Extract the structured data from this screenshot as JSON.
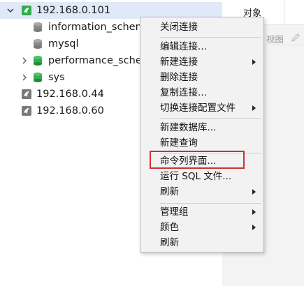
{
  "tree": {
    "connections": [
      {
        "label": "192.168.0.101",
        "expanded": true,
        "selected": true,
        "status": "connected"
      },
      {
        "label": "192.168.0.44",
        "status": "disconnected"
      },
      {
        "label": "192.168.0.60",
        "status": "disconnected"
      }
    ],
    "databases": [
      {
        "label": "information_schema",
        "color": "#8a8a8a",
        "expandable": false
      },
      {
        "label": "mysql",
        "color": "#8a8a8a",
        "expandable": false
      },
      {
        "label": "performance_schema",
        "color": "#2fae4a",
        "expandable": true
      },
      {
        "label": "sys",
        "color": "#2fae4a",
        "expandable": true
      }
    ]
  },
  "right_panel": {
    "object_tab": "对象",
    "view_label": "视图"
  },
  "context_menu": {
    "items": [
      {
        "label": "关闭连接"
      },
      {
        "label": "编辑连接..."
      },
      {
        "label": "新建连接",
        "submenu": true
      },
      {
        "label": "删除连接"
      },
      {
        "label": "复制连接..."
      },
      {
        "label": "切换连接配置文件",
        "submenu": true
      },
      {
        "label": "新建数据库..."
      },
      {
        "label": "新建查询"
      },
      {
        "label": "命令列界面...",
        "highlighted": true
      },
      {
        "label": "运行 SQL 文件..."
      },
      {
        "label": "刷新",
        "submenu": true
      },
      {
        "label": "管理组",
        "submenu": true
      },
      {
        "label": "颜色",
        "submenu": true
      },
      {
        "label": "刷新"
      }
    ]
  },
  "colors": {
    "selection": "#dfe9f7",
    "highlight_border": "#d03030",
    "connected_icon": "#2fae4a",
    "disconnected_icon": "#7a7a7a"
  }
}
